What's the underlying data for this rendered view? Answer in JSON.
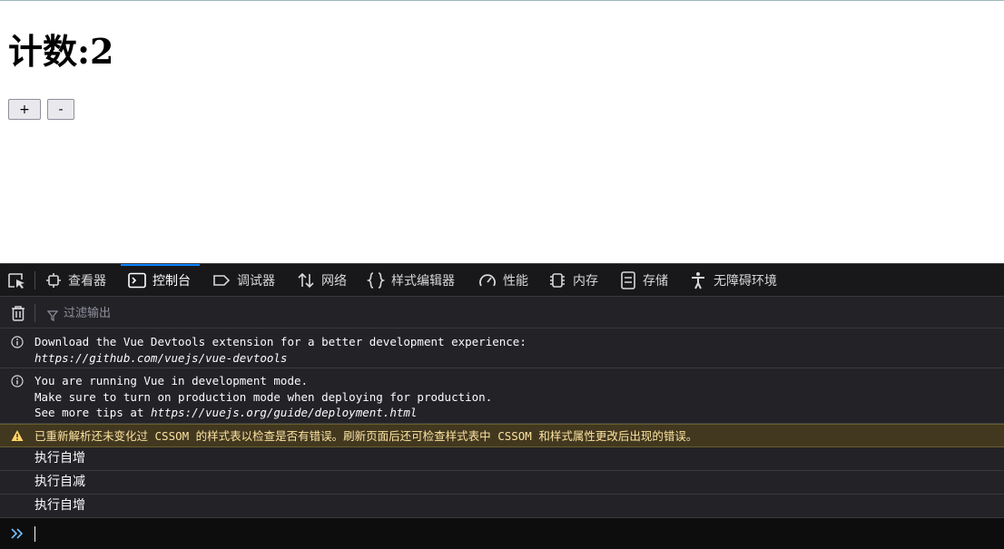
{
  "page": {
    "heading_label": "计数:",
    "count": "2",
    "plus_label": "+",
    "minus_label": "-"
  },
  "devtools": {
    "tabs": [
      {
        "label": "查看器",
        "icon": "inspector-icon"
      },
      {
        "label": "控制台",
        "icon": "console-icon",
        "active": true
      },
      {
        "label": "调试器",
        "icon": "debugger-icon"
      },
      {
        "label": "网络",
        "icon": "network-icon"
      },
      {
        "label": "样式编辑器",
        "icon": "style-editor-icon"
      },
      {
        "label": "性能",
        "icon": "performance-icon"
      },
      {
        "label": "内存",
        "icon": "memory-icon"
      },
      {
        "label": "存储",
        "icon": "storage-icon"
      },
      {
        "label": "无障碍环境",
        "icon": "accessibility-icon"
      }
    ],
    "filter_placeholder": "过滤输出",
    "messages": {
      "info1_line1": "Download the Vue Devtools extension for a better development experience:",
      "info1_link": "https://github.com/vuejs/vue-devtools",
      "info2_line1": "You are running Vue in development mode.",
      "info2_line2": "Make sure to turn on production mode when deploying for production.",
      "info2_line3_prefix": "See more tips at ",
      "info2_link": "https://vuejs.org/guide/deployment.html",
      "warning": "已重新解析还未变化过 CSSOM 的样式表以检查是否有错误。刷新页面后还可检查样式表中 CSSOM 和样式属性更改后出现的错误。",
      "logs": [
        "执行自增",
        "执行自减",
        "执行自增"
      ]
    },
    "colors": {
      "accent": "#0a84ff",
      "warning_bg": "#42381f",
      "warning_text": "#fce2a1",
      "panel_bg": "#232327"
    }
  }
}
